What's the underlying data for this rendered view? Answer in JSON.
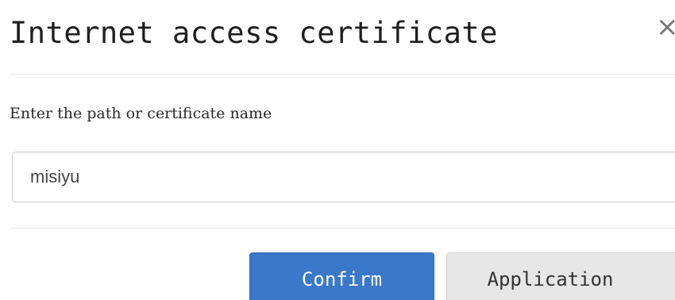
{
  "dialog": {
    "title": "Internet access certificate",
    "close_symbol": "×",
    "close_icon": "close-icon"
  },
  "form": {
    "label": "Enter the path or certificate name",
    "input_value": "misiyu"
  },
  "buttons": {
    "confirm_label": "Confirm",
    "application_label": "Application"
  },
  "colors": {
    "primary": "#3a78c9",
    "secondary": "#e6e6e6"
  }
}
